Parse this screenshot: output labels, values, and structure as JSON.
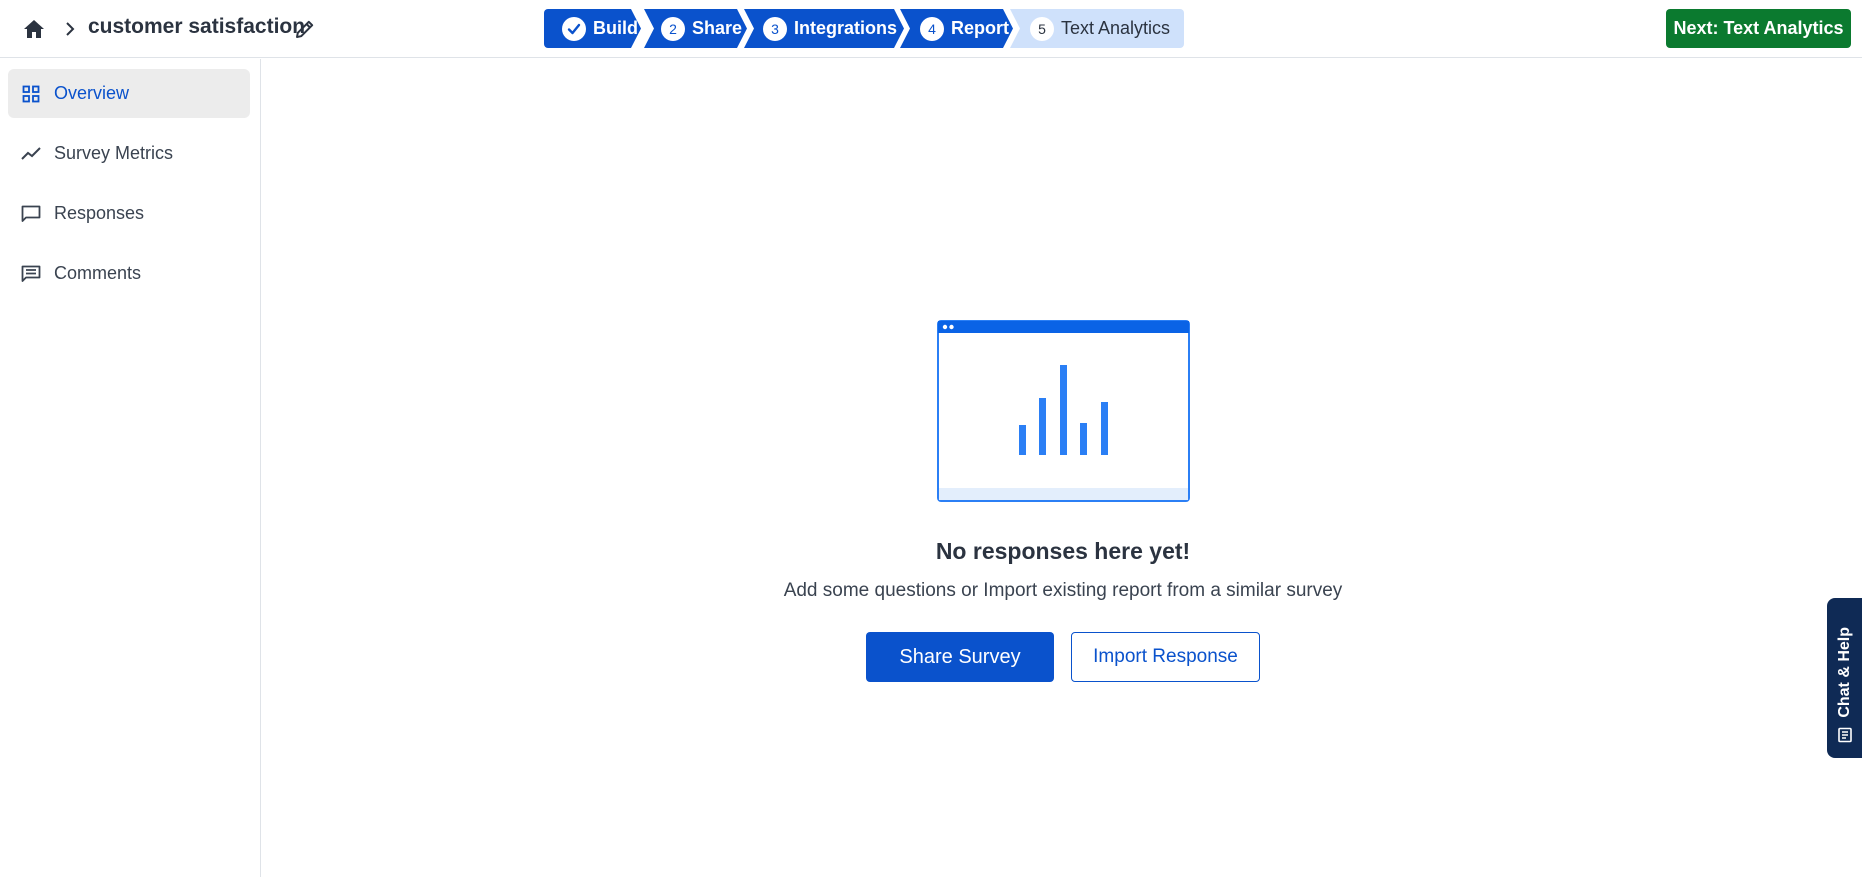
{
  "header": {
    "survey_title": "customer satisfaction",
    "icons": {
      "home": "home-icon",
      "chevron": "chevron-right-icon",
      "edit": "pencil-icon"
    },
    "next_button_label": "Next: Text Analytics"
  },
  "steps": [
    {
      "number": "",
      "label": "Build",
      "status": "done",
      "icon": "check-icon"
    },
    {
      "number": "2",
      "label": "Share",
      "status": "done"
    },
    {
      "number": "3",
      "label": "Integrations",
      "status": "done"
    },
    {
      "number": "4",
      "label": "Report",
      "status": "done"
    },
    {
      "number": "5",
      "label": "Text Analytics",
      "status": "pending"
    }
  ],
  "sidebar": {
    "items": [
      {
        "label": "Overview",
        "icon": "grid-icon",
        "active": true
      },
      {
        "label": "Survey Metrics",
        "icon": "trend-line-icon",
        "active": false
      },
      {
        "label": "Responses",
        "icon": "speech-bubble-icon",
        "active": false
      },
      {
        "label": "Comments",
        "icon": "comment-lines-icon",
        "active": false
      }
    ]
  },
  "empty_state": {
    "title": "No responses here yet!",
    "subtitle": "Add some questions or Import existing report from a similar survey",
    "primary_button": "Share Survey",
    "secondary_button": "Import Response",
    "illustration_icon": "bar-chart-window-icon"
  },
  "chat_help": {
    "label": "Chat & Help",
    "icon": "chat-document-icon"
  },
  "colors": {
    "primary": "#0a52cc",
    "step_pending": "#cfe1fb",
    "next_green": "#0b7a2f",
    "chat_navy": "#0f2a55",
    "active_nav_bg": "#ececec",
    "illustration_blue": "#2b7ff5"
  }
}
